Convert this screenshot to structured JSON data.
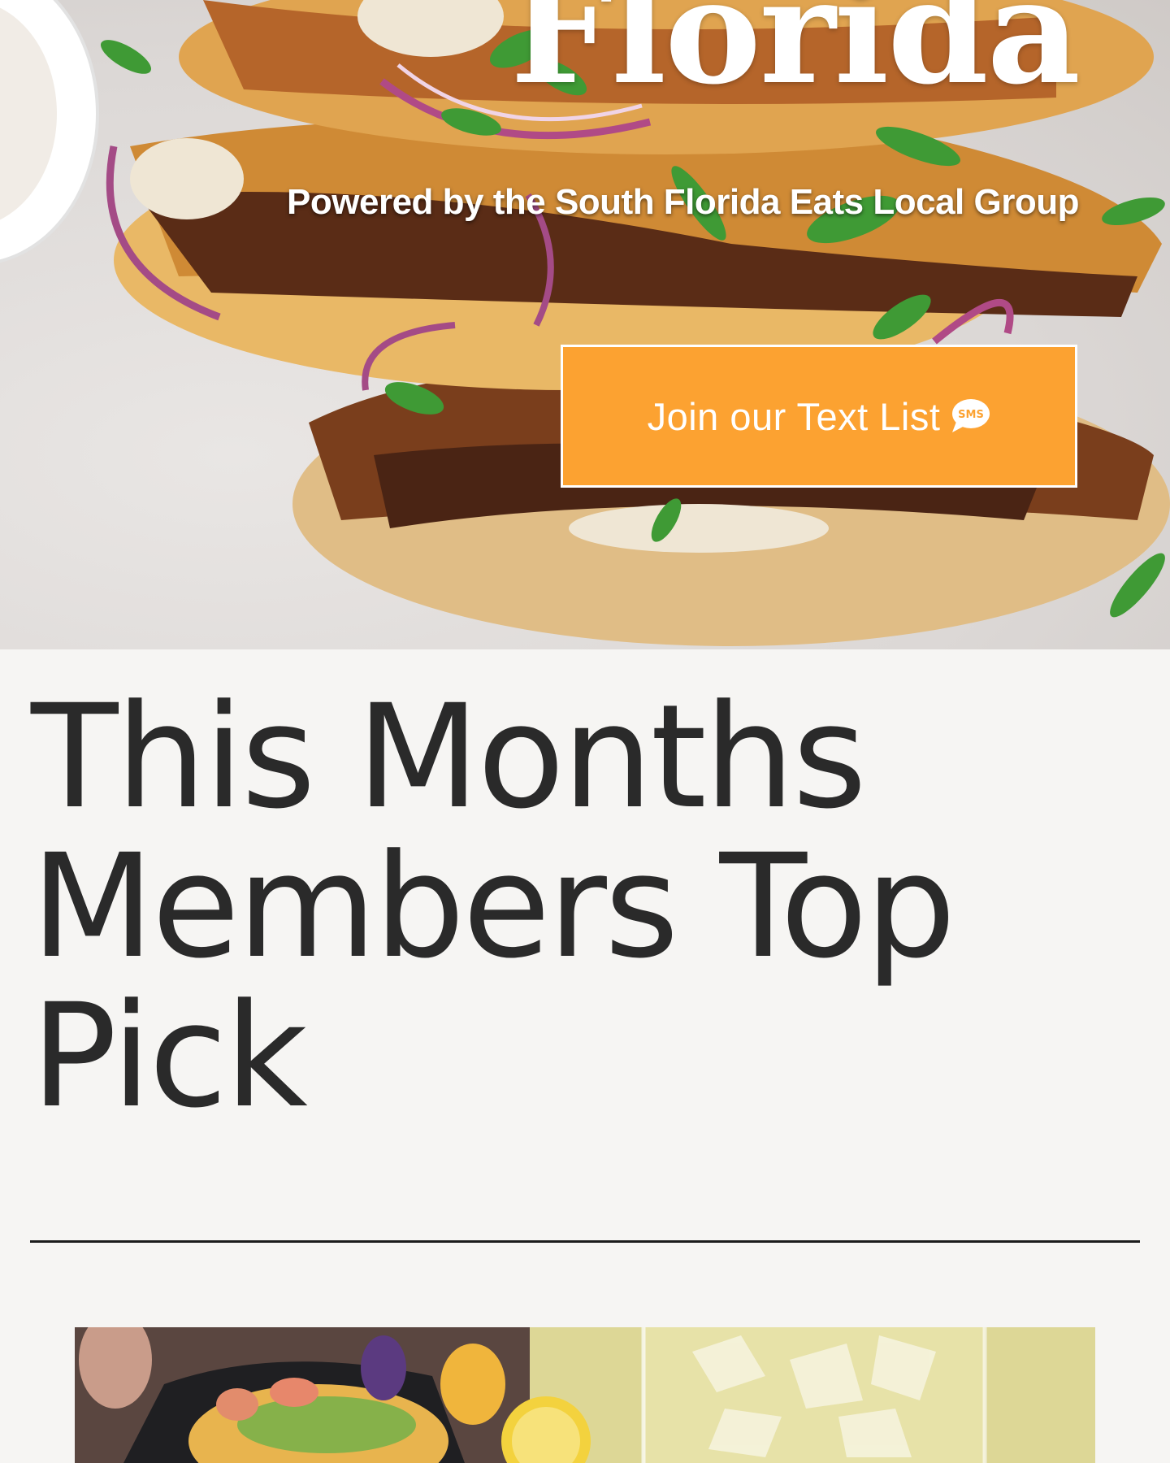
{
  "hero": {
    "title": "Florida",
    "subtitle": "Powered by the South Florida Eats Local Group",
    "cta_label": "Join our Text List",
    "cta_icon": "sms-chat-icon",
    "cta_icon_text": "SMS",
    "cta_color": "#fca231"
  },
  "main": {
    "section_title": "This Months Members Top Pick"
  },
  "colors": {
    "page_background": "#f6f5f3",
    "heading_text": "#2a2a2a",
    "divider": "#1c1c1c"
  }
}
